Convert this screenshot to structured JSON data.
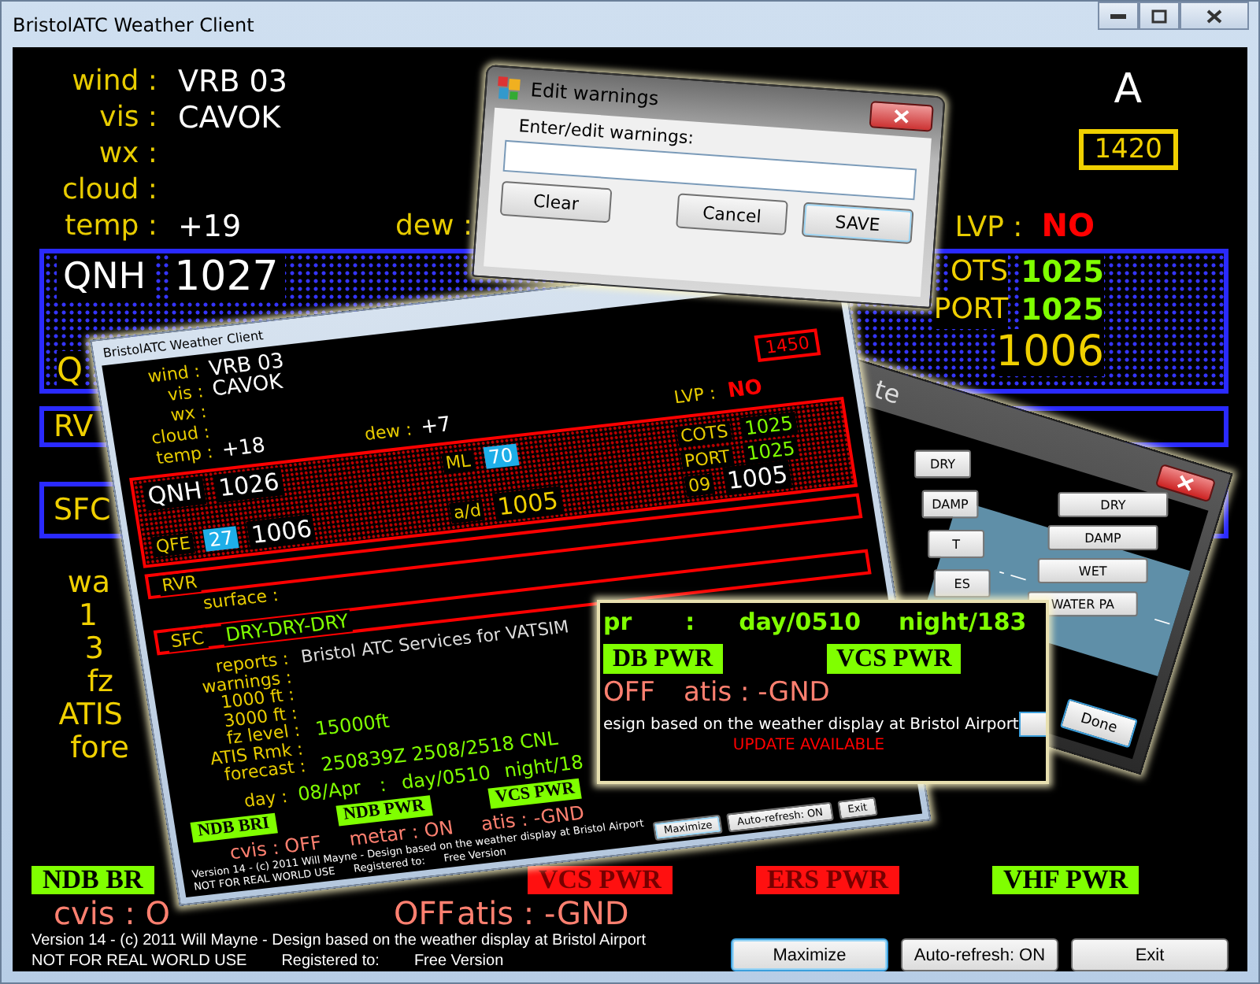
{
  "window": {
    "title": "BristolATC Weather Client"
  },
  "main": {
    "weather": [
      {
        "label": "wind :",
        "value": "VRB 03"
      },
      {
        "label": "vis :",
        "value": "CAVOK"
      },
      {
        "label": "wx :"
      },
      {
        "label": "cloud :"
      },
      {
        "label": "temp :",
        "value": "+19"
      }
    ],
    "dew_label": "dew :",
    "atis_letter": "A",
    "time": "1420",
    "lvp": {
      "label": "LVP :",
      "value": "NO"
    },
    "pressure": {
      "qnh_label": "QNH",
      "qnh_value": "1027",
      "cots_label": "OTS",
      "cots_value": "1025",
      "port_label": "PORT",
      "port_value": "1025",
      "qfe_label": "Q",
      "qfe_value": "1006"
    },
    "rvr_label": "RV",
    "sfc_label": "SFC",
    "info_labels": [
      "wa",
      "1",
      "3",
      "fz",
      "ATIS",
      "fore"
    ],
    "indicators": [
      {
        "label": "NDB BR",
        "on": true
      },
      {
        "label": "VCS PWR",
        "on": false
      },
      {
        "label": "ERS PWR",
        "on": false
      },
      {
        "label": "VHF PWR",
        "on": true
      }
    ],
    "status": [
      "cvis : O",
      "OFF",
      "atis : -GND"
    ],
    "footer": {
      "credit": "Version 14 - (c) 2011 Will Mayne - Design based on the weather display at Bristol Airport",
      "disclaimer": "NOT FOR REAL WORLD USE",
      "registered_label": "Registered to:",
      "registered_value": "Free Version"
    },
    "buttons": [
      {
        "label": "Maximize",
        "focused": true
      },
      {
        "label": "Auto-refresh: ON",
        "focused": false
      },
      {
        "label": "Exit",
        "focused": false
      }
    ]
  },
  "surface_dialog": {
    "title": "te",
    "left_buttons": [
      "DRY",
      "DAMP",
      "T",
      "ES"
    ],
    "right_buttons": [
      "DRY",
      "DAMP",
      "WET",
      "WATER PA"
    ],
    "dashes": [
      "- —",
      "—"
    ],
    "done": "Done"
  },
  "inner_window": {
    "title": "BristolATC Weather Client",
    "weather": [
      {
        "label": "wind :",
        "value": "VRB 03"
      },
      {
        "label": "vis :",
        "value": "CAVOK"
      },
      {
        "label": "wx :"
      },
      {
        "label": "cloud :"
      },
      {
        "label": "temp :",
        "value": "+18"
      }
    ],
    "dew": {
      "label": "dew :",
      "value": "+7"
    },
    "time": "1450",
    "lvp": {
      "label": "LVP :",
      "value": "NO"
    },
    "pressure": {
      "qnh_label": "QNH",
      "qnh_value": "1026",
      "ml_label": "ML",
      "ml_value": "70",
      "cots_label": "COTS",
      "cots_value": "1025",
      "port_label": "PORT",
      "port_value": "1025",
      "qfe_label": "QFE",
      "qfe_runway": "27",
      "qfe_value": "1006",
      "ad_label": "a/d",
      "ad_value": "1005",
      "rwy_label": "09",
      "rwy_value": "1005"
    },
    "rvr_label": "RVR",
    "surface_label": "surface :",
    "sfc": {
      "label": "SFC",
      "value": "DRY-DRY-DRY"
    },
    "reports": {
      "label": "reports :",
      "value": "Bristol ATC Services for VATSIM"
    },
    "info": [
      {
        "label": "warnings :"
      },
      {
        "label": "1000 ft :"
      },
      {
        "label": "3000 ft :"
      },
      {
        "label": "fz level :",
        "value": "15000ft"
      },
      {
        "label": "ATIS Rmk :"
      },
      {
        "label": "forecast :",
        "value": "250839Z 2508/2518 CNL"
      }
    ],
    "sun": {
      "label": "day :",
      "date": "08/Apr",
      "separator": ":",
      "day": "day/0510",
      "night": "night/18"
    },
    "indicators": [
      {
        "label": "NDB BRI",
        "on": true
      },
      {
        "label": "NDB PWR",
        "on": true
      },
      {
        "label": "VCS PWR",
        "on": true
      }
    ],
    "status": [
      "cvis : OFF",
      "metar : ON",
      "atis : -GND"
    ],
    "footer": {
      "credit": "Version 14 - (c) 2011 Will Mayne - Design based on the weather display at Bristol Airport",
      "disclaimer": "NOT FOR REAL WORLD USE",
      "registered_label": "Registered to:",
      "registered_value": "Free Version"
    },
    "buttons": [
      {
        "label": "Maximize",
        "focused": true
      },
      {
        "label": "Auto-refresh: ON",
        "focused": false
      },
      {
        "label": "Exit",
        "focused": false
      }
    ]
  },
  "zoom_window": {
    "sun": [
      "pr",
      ":",
      "day/0510",
      "night/183"
    ],
    "indicators": [
      {
        "label": "DB PWR",
        "on": true
      },
      {
        "label": "VCS PWR",
        "on": true
      }
    ],
    "status": [
      "OFF",
      "atis : -GND"
    ],
    "credit": "esign based on the weather display at Bristol Airport",
    "update": "UPDATE AVAILABLE"
  },
  "edit_dialog": {
    "title": "Edit warnings",
    "prompt": "Enter/edit warnings:",
    "buttons": [
      {
        "label": "Clear",
        "focused": false
      },
      {
        "label": "Cancel",
        "focused": false
      },
      {
        "label": "SAVE",
        "focused": true
      }
    ]
  }
}
